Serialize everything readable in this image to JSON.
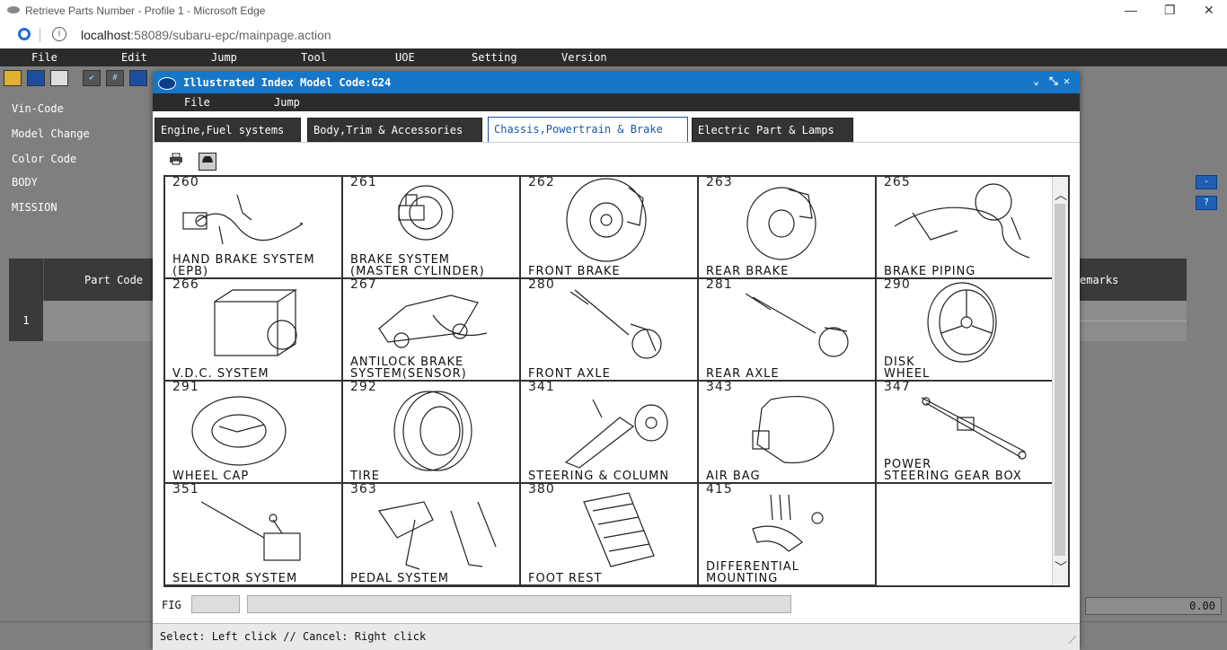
{
  "browser": {
    "title": "Retrieve Parts Number - Profile 1 - Microsoft Edge",
    "url_host": "localhost",
    "url_rest": ":58089/subaru-epc/mainpage.action",
    "controls": [
      "—",
      "❐",
      "✕"
    ]
  },
  "app_menu": [
    "File",
    "Edit",
    "Jump",
    "Tool",
    "UOE",
    "Setting",
    "Version"
  ],
  "toolbar_icons": [
    "open-folder-icon",
    "save-icon",
    "print-icon",
    "check-icon",
    "number-icon",
    "save-as-icon"
  ],
  "sidebar": [
    "Vin-Code",
    "Model Change",
    "Color Code",
    "BODY",
    "MISSION"
  ],
  "bg_table": {
    "header_part_code": "Part Code",
    "header_remarks": "emarks",
    "row_number": "1"
  },
  "right_buttons": [
    "-",
    "?"
  ],
  "total_value": "0.00",
  "dialog": {
    "title": "Illustrated Index Model Code:G24",
    "title_controls": [
      "⌄",
      "⤡",
      "✕"
    ],
    "menu": [
      "File",
      "Jump"
    ],
    "tabs": [
      {
        "label": "Engine,Fuel systems",
        "active": false
      },
      {
        "label": "Body,Trim & Accessories",
        "active": false
      },
      {
        "label": "Chassis,Powertrain & Brake",
        "active": true
      },
      {
        "label": "Electric Part & Lamps",
        "active": false
      }
    ],
    "tools": [
      "print-icon",
      "car-icon"
    ],
    "items": [
      {
        "num": "260",
        "label": "HAND BRAKE SYSTEM\n(EPB)"
      },
      {
        "num": "261",
        "label": "BRAKE SYSTEM\n(MASTER CYLINDER)"
      },
      {
        "num": "262",
        "label": "FRONT BRAKE"
      },
      {
        "num": "263",
        "label": "REAR BRAKE"
      },
      {
        "num": "265",
        "label": "BRAKE PIPING"
      },
      {
        "num": "266",
        "label": "V.D.C. SYSTEM"
      },
      {
        "num": "267",
        "label": "ANTILOCK BRAKE\nSYSTEM(SENSOR)"
      },
      {
        "num": "280",
        "label": "FRONT AXLE"
      },
      {
        "num": "281",
        "label": "REAR AXLE"
      },
      {
        "num": "290",
        "label": "DISK\nWHEEL"
      },
      {
        "num": "291",
        "label": "WHEEL CAP"
      },
      {
        "num": "292",
        "label": "TIRE"
      },
      {
        "num": "341",
        "label": "STEERING & COLUMN"
      },
      {
        "num": "343",
        "label": "AIR BAG"
      },
      {
        "num": "347",
        "label": "POWER\nSTEERING GEAR BOX"
      },
      {
        "num": "351",
        "label": "SELECTOR SYSTEM"
      },
      {
        "num": "363",
        "label": "PEDAL SYSTEM"
      },
      {
        "num": "380",
        "label": "FOOT REST"
      },
      {
        "num": "415",
        "label": "DIFFERENTIAL\nMOUNTING"
      },
      {
        "num": "",
        "label": ""
      }
    ],
    "fig_label": "FIG",
    "status": "Select: Left click // Cancel: Right click"
  }
}
